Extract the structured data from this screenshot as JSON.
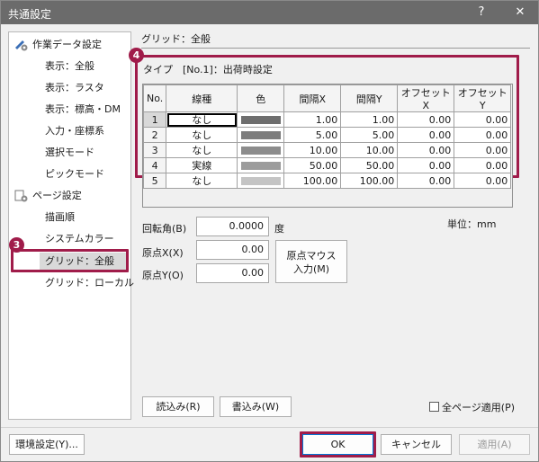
{
  "window": {
    "title": "共通設定",
    "help_label": "?",
    "close_label": "✕"
  },
  "nav": {
    "items": [
      {
        "label": "作業データ設定",
        "kind": "parent"
      },
      {
        "label": "表示：全般",
        "kind": "child"
      },
      {
        "label": "表示：ラスタ",
        "kind": "child"
      },
      {
        "label": "表示：標高・DM",
        "kind": "child"
      },
      {
        "label": "入力・座標系",
        "kind": "child"
      },
      {
        "label": "選択モード",
        "kind": "child"
      },
      {
        "label": "ピックモード",
        "kind": "child"
      },
      {
        "label": "ページ設定",
        "kind": "parent"
      },
      {
        "label": "描画順",
        "kind": "child"
      },
      {
        "label": "システムカラー",
        "kind": "child"
      },
      {
        "label": "グリッド：全般",
        "kind": "child",
        "selected": true
      },
      {
        "label": "グリッド：ローカル",
        "kind": "child"
      }
    ]
  },
  "section": {
    "title": "グリッド：全般"
  },
  "type": {
    "label": "タイプ",
    "value": "[No.1]：出荷時設定"
  },
  "grid": {
    "columns": [
      "No.",
      "線種",
      "色",
      "間隔X",
      "間隔Y",
      "オフセットX",
      "オフセットY"
    ],
    "rows": [
      {
        "no": "1",
        "line": "なし",
        "color": "#6e6e6e",
        "dx": "1.00",
        "dy": "1.00",
        "ox": "0.00",
        "oy": "0.00"
      },
      {
        "no": "2",
        "line": "なし",
        "color": "#7d7d7d",
        "dx": "5.00",
        "dy": "5.00",
        "ox": "0.00",
        "oy": "0.00"
      },
      {
        "no": "3",
        "line": "なし",
        "color": "#8c8c8c",
        "dx": "10.00",
        "dy": "10.00",
        "ox": "0.00",
        "oy": "0.00"
      },
      {
        "no": "4",
        "line": "実線",
        "color": "#9c9c9c",
        "dx": "50.00",
        "dy": "50.00",
        "ox": "0.00",
        "oy": "0.00"
      },
      {
        "no": "5",
        "line": "なし",
        "color": "#c4c4c4",
        "dx": "100.00",
        "dy": "100.00",
        "ox": "0.00",
        "oy": "0.00"
      }
    ]
  },
  "params": {
    "rotation_label": "回転角(B)",
    "rotation_value": "0.0000",
    "rotation_unit": "度",
    "origin_x_label": "原点X(X)",
    "origin_x_value": "0.00",
    "origin_y_label": "原点Y(O)",
    "origin_y_value": "0.00",
    "unit_text": "単位：mm",
    "origin_mouse_line1": "原点マウス",
    "origin_mouse_line2": "入力(M)"
  },
  "buttons": {
    "load": "読込み(R)",
    "write": "書込み(W)",
    "apply_all": "全ページ適用(P)",
    "env": "環境設定(Y)...",
    "ok": "OK",
    "cancel": "キャンセル",
    "apply": "適用(A)"
  },
  "annotations": {
    "badge3": "3",
    "badge4": "4"
  },
  "colors": {
    "accent": "#a01c4a",
    "titlebar": "#6b6b6b",
    "focus": "#0078d7"
  }
}
